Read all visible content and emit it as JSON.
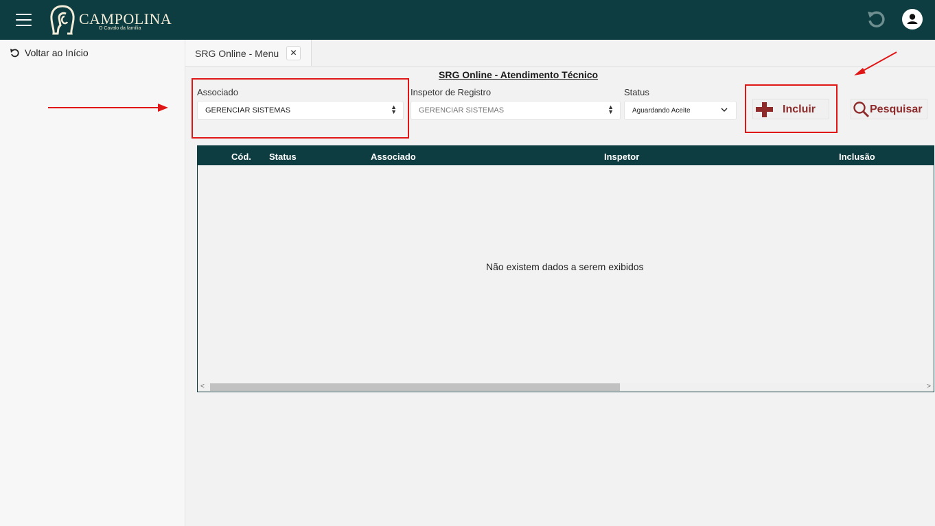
{
  "header": {
    "brand": "CAMPOLINA",
    "tagline": "O Cavalo da família",
    "menu_icon": "hamburger-icon",
    "refresh_icon": "refresh-icon",
    "user_icon": "user-avatar-icon",
    "bar_color": "#0d3d41"
  },
  "sidebar": {
    "back_label": "Voltar ao Início",
    "back_icon": "undo-icon"
  },
  "tabs": [
    {
      "label": "SRG Online - Menu",
      "close": "✕"
    }
  ],
  "main": {
    "title": "SRG Online - Atendimento Técnico",
    "filters": {
      "associado": {
        "label": "Associado",
        "value": "GERENCIAR SISTEMAS"
      },
      "inspetor": {
        "label": "Inspetor de Registro",
        "value": "GERENCIAR SISTEMAS"
      },
      "status": {
        "label": "Status",
        "value": "Aguardando Aceite"
      }
    },
    "buttons": {
      "incluir": "Incluir",
      "pesquisar": "Pesquisar"
    },
    "table": {
      "columns": [
        "Cód.",
        "Status",
        "Associado",
        "Inspetor",
        "Inclusão"
      ],
      "empty_message": "Não existem dados a serem exibidos"
    }
  },
  "colors": {
    "accent": "#0d3d41",
    "highlight": "#e01515",
    "button_text": "#8e2a2a"
  }
}
